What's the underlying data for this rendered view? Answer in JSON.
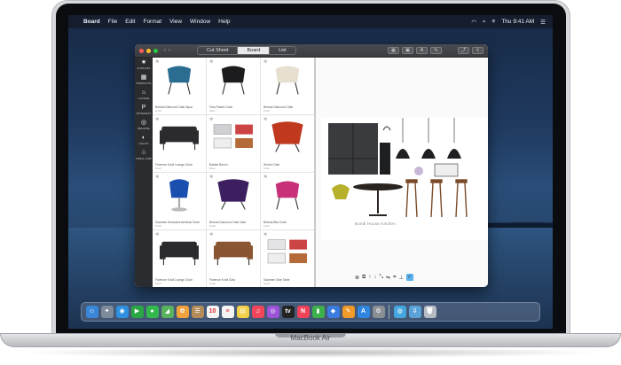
{
  "menubar": {
    "app": "Board",
    "items": [
      "File",
      "Edit",
      "Format",
      "View",
      "Window",
      "Help"
    ],
    "clock": "Thu 9:41 AM"
  },
  "window": {
    "tabs": [
      "Cut Sheet",
      "Board",
      "List"
    ],
    "active_tab": "Board",
    "sidebar": [
      {
        "icon": "star-icon",
        "glyph": "★",
        "label": "FURN-MIX"
      },
      {
        "icon": "furniture-icon",
        "glyph": "▦",
        "label": "PRODUCTS"
      },
      {
        "icon": "chair-icon",
        "glyph": "⌂",
        "label": "LOUNGE"
      },
      {
        "icon": "pinterest-icon",
        "glyph": "P",
        "label": "PINTEREST"
      },
      {
        "icon": "compass-icon",
        "glyph": "◎",
        "label": "BROWSE"
      },
      {
        "icon": "light-icon",
        "glyph": "◐",
        "label": "LIGHTS"
      },
      {
        "icon": "lamp-icon",
        "glyph": "♧",
        "label": "TABLE LAMP"
      }
    ],
    "products": [
      {
        "name": "Bertoia Diamond Chair Aqua",
        "sub": "Knoll",
        "color": "#2a6d91",
        "shape": "chair"
      },
      {
        "name": "Vitra Plastic Chair",
        "sub": "Vitra",
        "color": "#1c1c1e",
        "shape": "chair"
      },
      {
        "name": "Bertoia Diamond Chair",
        "sub": "Knoll",
        "color": "#e7dfcf",
        "shape": "chair"
      },
      {
        "name": "Florence Knoll Lounge Chair",
        "sub": "Knoll",
        "color": "#2b2b2d",
        "shape": "sofa"
      },
      {
        "name": "Babled Bench",
        "sub": "Bowl",
        "color": "#cfcfd4",
        "shape": "mixed"
      },
      {
        "name": "Womb Chair",
        "sub": "Knoll",
        "color": "#c0391f",
        "shape": "lounge"
      },
      {
        "name": "Saarinen Executive Armless Chair",
        "sub": "Knoll",
        "color": "#1a4fb0",
        "shape": "tulip"
      },
      {
        "name": "Bertoia Diamond Chair Dark",
        "sub": "Knoll",
        "color": "#3b1f5e",
        "shape": "lounge"
      },
      {
        "name": "Bertoia Bird Chair",
        "sub": "Knoll",
        "color": "#c8307a",
        "shape": "chair"
      },
      {
        "name": "Florence Knoll Lounge Chair",
        "sub": "Knoll",
        "color": "#2b2b2d",
        "shape": "sofa"
      },
      {
        "name": "Florence Knoll Sofa",
        "sub": "Knoll",
        "color": "#8a5532",
        "shape": "sofa"
      },
      {
        "name": "Saarinen Side Table",
        "sub": "Knoll",
        "color": "#e5e5e8",
        "shape": "mixed"
      }
    ],
    "board_caption": "Bondi House Kitchen"
  },
  "dock": [
    "finder",
    "launchpad",
    "safari",
    "facetime",
    "messages",
    "maps",
    "photos",
    "contacts",
    "calendar",
    "reminders",
    "notes",
    "music",
    "podcasts",
    "tv",
    "news",
    "numbers",
    "keynote",
    "pages",
    "app-store",
    "settings",
    "board",
    "downloads",
    "trash"
  ],
  "brand": "MacBook Air"
}
